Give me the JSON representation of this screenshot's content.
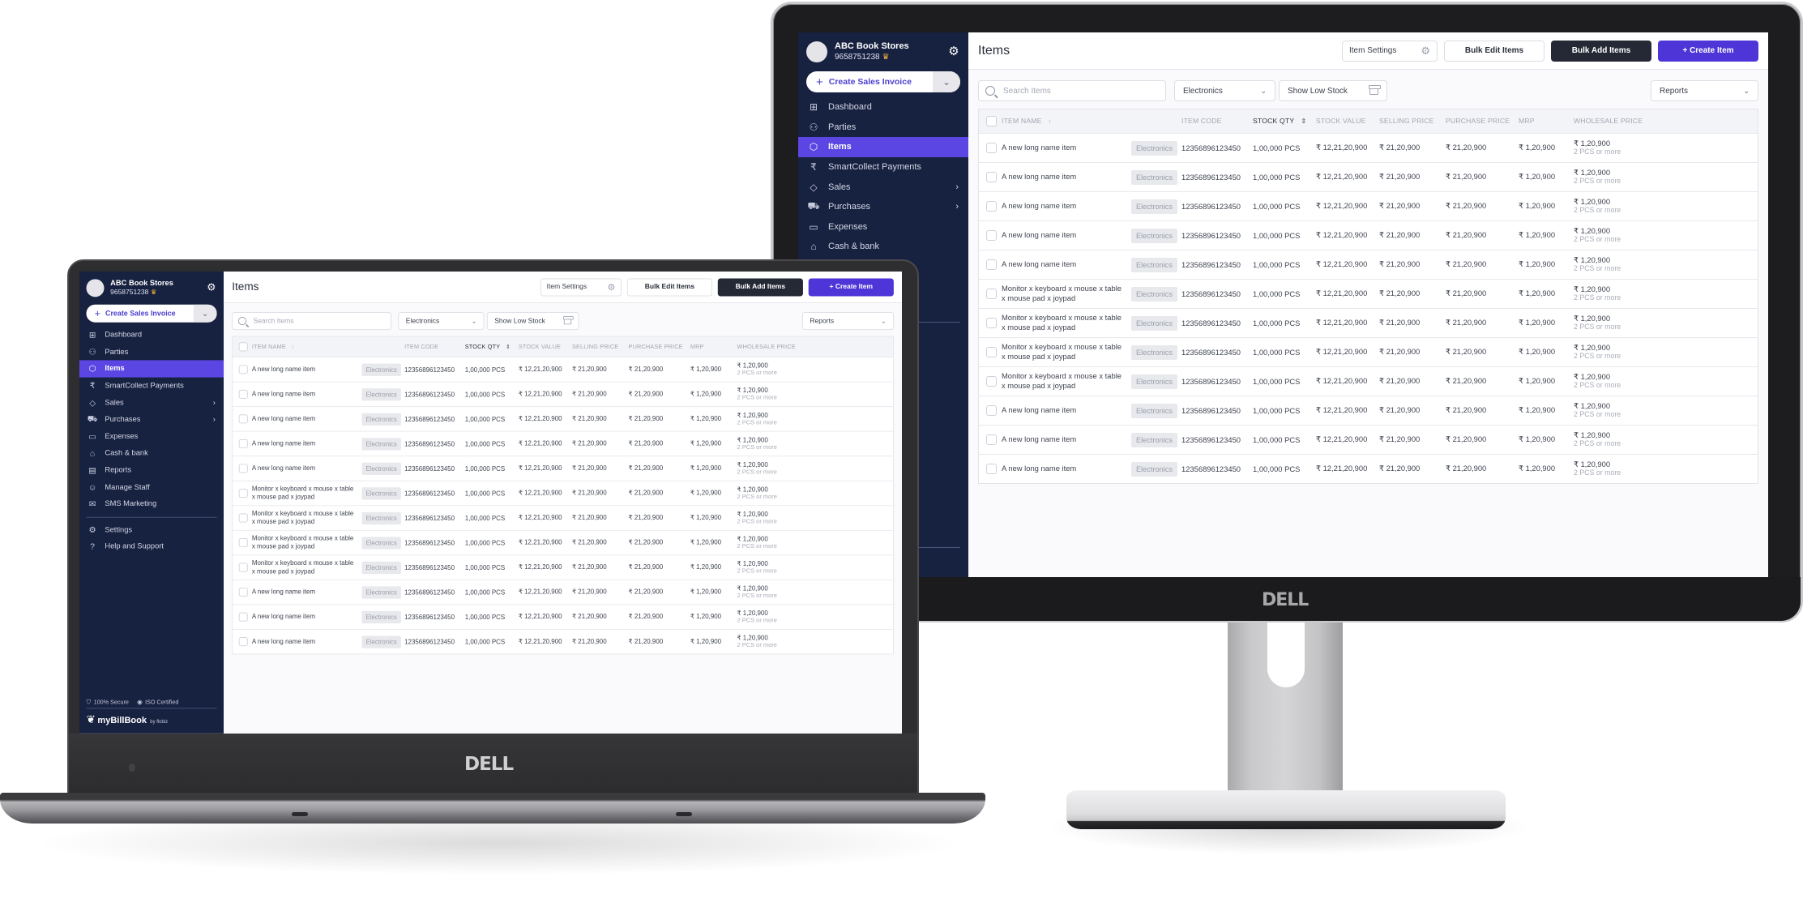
{
  "devices": [
    "monitor",
    "laptop"
  ],
  "brand": {
    "device_logo": "DELL",
    "app_name": "myBillBook",
    "by_label": "by",
    "company": "flobiz"
  },
  "colors": {
    "sidebar_bg": "#172140",
    "accent": "#5b46e3",
    "primary_button": "#4d35d8",
    "dark_button": "#242935"
  },
  "sidebar": {
    "business_name": "ABC Book Stores",
    "phone": "9658751238",
    "premium_icon": "crown-icon",
    "settings_icon": "gear-icon",
    "create_invoice_label": "Create Sales Invoice",
    "items": [
      {
        "label": "Dashboard",
        "icon": "dashboard-icon",
        "glyph": "⊞",
        "active": false,
        "expandable": false
      },
      {
        "label": "Parties",
        "icon": "users-icon",
        "glyph": "⚇",
        "active": false,
        "expandable": false
      },
      {
        "label": "Items",
        "icon": "box-icon",
        "glyph": "⬡",
        "active": true,
        "expandable": false
      },
      {
        "label": "SmartCollect Payments",
        "icon": "rupee-icon",
        "glyph": "₹",
        "active": false,
        "expandable": false
      },
      {
        "label": "Sales",
        "icon": "tag-icon",
        "glyph": "◇",
        "active": false,
        "expandable": true
      },
      {
        "label": "Purchases",
        "icon": "cart-icon",
        "glyph": "⛟",
        "active": false,
        "expandable": true
      },
      {
        "label": "Expenses",
        "icon": "wallet-icon",
        "glyph": "▭",
        "active": false,
        "expandable": false
      },
      {
        "label": "Cash & bank",
        "icon": "bank-icon",
        "glyph": "⌂",
        "active": false,
        "expandable": false
      },
      {
        "label": "Reports",
        "icon": "report-icon",
        "glyph": "▤",
        "active": false,
        "expandable": false
      },
      {
        "label": "Manage Staff",
        "icon": "staff-icon",
        "glyph": "☺",
        "active": false,
        "expandable": false
      },
      {
        "label": "SMS Marketing",
        "icon": "sms-icon",
        "glyph": "✉",
        "active": false,
        "expandable": false
      }
    ],
    "secondary_items": [
      {
        "label": "Settings",
        "icon": "settings-icon",
        "glyph": "⚙"
      },
      {
        "label": "Help and Support",
        "icon": "help-icon",
        "glyph": "?"
      }
    ],
    "badges": [
      {
        "label": "100% Secure",
        "icon": "shield-icon",
        "glyph": "⛉"
      },
      {
        "label": "ISO Certified",
        "icon": "iso-icon",
        "glyph": "◉"
      }
    ]
  },
  "header": {
    "title": "Items",
    "item_settings_label": "Item Settings",
    "bulk_edit_label": "Bulk Edit Items",
    "bulk_add_label": "Bulk Add Items",
    "create_item_label": "+ Create Item"
  },
  "filters": {
    "search_placeholder": "Search Items",
    "search_value": "",
    "category_selected": "Electronics",
    "low_stock_label": "Show Low Stock",
    "reports_selected": "Reports"
  },
  "table": {
    "columns": [
      {
        "key": "name",
        "label": "ITEM NAME",
        "sortable": true,
        "active": false
      },
      {
        "key": "category",
        "label": "",
        "sortable": false,
        "active": false
      },
      {
        "key": "code",
        "label": "ITEM CODE",
        "sortable": false,
        "active": false
      },
      {
        "key": "qty",
        "label": "STOCK QTY",
        "sortable": true,
        "active": true
      },
      {
        "key": "value",
        "label": "STOCK VALUE",
        "sortable": false,
        "active": false
      },
      {
        "key": "selling",
        "label": "SELLING PRICE",
        "sortable": false,
        "active": false
      },
      {
        "key": "purchase",
        "label": "PURCHASE PRICE",
        "sortable": false,
        "active": false
      },
      {
        "key": "mrp",
        "label": "MRP",
        "sortable": false,
        "active": false
      },
      {
        "key": "wholesale",
        "label": "WHOLESALE PRICE",
        "sortable": false,
        "active": false
      }
    ],
    "rows": [
      {
        "name": "A new long name item",
        "category": "Electronics",
        "code": "12356896123450",
        "qty": "1,00,000 PCS",
        "value": "₹ 12,21,20,900",
        "selling": "₹ 21,20,900",
        "purchase": "₹ 21,20,900",
        "mrp": "₹ 1,20,900",
        "wholesale": "₹ 1,20,900",
        "wholesale_note": "2 PCS or more"
      },
      {
        "name": "A new long name item",
        "category": "Electronics",
        "code": "12356896123450",
        "qty": "1,00,000 PCS",
        "value": "₹ 12,21,20,900",
        "selling": "₹ 21,20,900",
        "purchase": "₹ 21,20,900",
        "mrp": "₹ 1,20,900",
        "wholesale": "₹ 1,20,900",
        "wholesale_note": "2 PCS or more"
      },
      {
        "name": "A new long name item",
        "category": "Electronics",
        "code": "12356896123450",
        "qty": "1,00,000 PCS",
        "value": "₹ 12,21,20,900",
        "selling": "₹ 21,20,900",
        "purchase": "₹ 21,20,900",
        "mrp": "₹ 1,20,900",
        "wholesale": "₹ 1,20,900",
        "wholesale_note": "2 PCS or more"
      },
      {
        "name": "A new long name item",
        "category": "Electronics",
        "code": "12356896123450",
        "qty": "1,00,000 PCS",
        "value": "₹ 12,21,20,900",
        "selling": "₹ 21,20,900",
        "purchase": "₹ 21,20,900",
        "mrp": "₹ 1,20,900",
        "wholesale": "₹ 1,20,900",
        "wholesale_note": "2 PCS or more"
      },
      {
        "name": "A new long name item",
        "category": "Electronics",
        "code": "12356896123450",
        "qty": "1,00,000 PCS",
        "value": "₹ 12,21,20,900",
        "selling": "₹ 21,20,900",
        "purchase": "₹ 21,20,900",
        "mrp": "₹ 1,20,900",
        "wholesale": "₹ 1,20,900",
        "wholesale_note": "2 PCS or more"
      },
      {
        "name": "Monitor x keyboard x mouse x table x mouse pad x joypad",
        "category": "Electronics",
        "code": "12356896123450",
        "qty": "1,00,000 PCS",
        "value": "₹ 12,21,20,900",
        "selling": "₹ 21,20,900",
        "purchase": "₹ 21,20,900",
        "mrp": "₹ 1,20,900",
        "wholesale": "₹ 1,20,900",
        "wholesale_note": "2 PCS or more"
      },
      {
        "name": "Monitor x keyboard x mouse x table x mouse pad x joypad",
        "category": "Electronics",
        "code": "12356896123450",
        "qty": "1,00,000 PCS",
        "value": "₹ 12,21,20,900",
        "selling": "₹ 21,20,900",
        "purchase": "₹ 21,20,900",
        "mrp": "₹ 1,20,900",
        "wholesale": "₹ 1,20,900",
        "wholesale_note": "2 PCS or more"
      },
      {
        "name": "Monitor x keyboard x mouse x table x mouse pad x joypad",
        "category": "Electronics",
        "code": "12356896123450",
        "qty": "1,00,000 PCS",
        "value": "₹ 12,21,20,900",
        "selling": "₹ 21,20,900",
        "purchase": "₹ 21,20,900",
        "mrp": "₹ 1,20,900",
        "wholesale": "₹ 1,20,900",
        "wholesale_note": "2 PCS or more"
      },
      {
        "name": "Monitor x keyboard x mouse x table x mouse pad x joypad",
        "category": "Electronics",
        "code": "12356896123450",
        "qty": "1,00,000 PCS",
        "value": "₹ 12,21,20,900",
        "selling": "₹ 21,20,900",
        "purchase": "₹ 21,20,900",
        "mrp": "₹ 1,20,900",
        "wholesale": "₹ 1,20,900",
        "wholesale_note": "2 PCS or more"
      },
      {
        "name": "A new long name item",
        "category": "Electronics",
        "code": "12356896123450",
        "qty": "1,00,000 PCS",
        "value": "₹ 12,21,20,900",
        "selling": "₹ 21,20,900",
        "purchase": "₹ 21,20,900",
        "mrp": "₹ 1,20,900",
        "wholesale": "₹ 1,20,900",
        "wholesale_note": "2 PCS or more"
      },
      {
        "name": "A new long name item",
        "category": "Electronics",
        "code": "12356896123450",
        "qty": "1,00,000 PCS",
        "value": "₹ 12,21,20,900",
        "selling": "₹ 21,20,900",
        "purchase": "₹ 21,20,900",
        "mrp": "₹ 1,20,900",
        "wholesale": "₹ 1,20,900",
        "wholesale_note": "2 PCS or more"
      },
      {
        "name": "A new long name item",
        "category": "Electronics",
        "code": "12356896123450",
        "qty": "1,00,000 PCS",
        "value": "₹ 12,21,20,900",
        "selling": "₹ 21,20,900",
        "purchase": "₹ 21,20,900",
        "mrp": "₹ 1,20,900",
        "wholesale": "₹ 1,20,900",
        "wholesale_note": "2 PCS or more"
      }
    ]
  }
}
